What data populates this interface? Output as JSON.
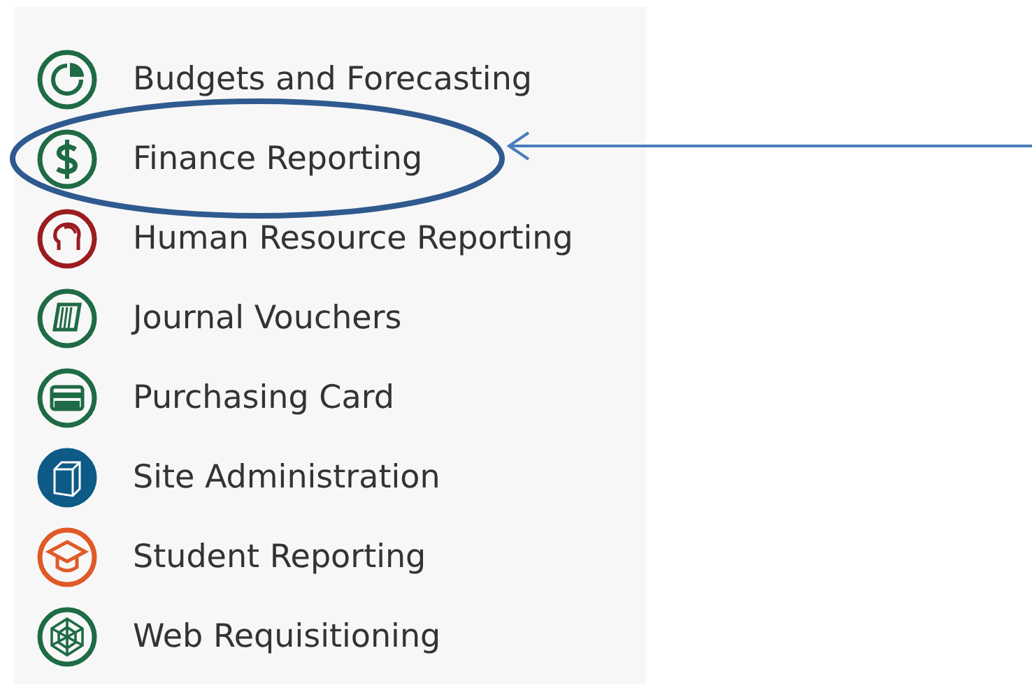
{
  "menu": {
    "items": [
      {
        "label": "Budgets and Forecasting",
        "kind": "pie",
        "color": "#1e6b45",
        "highlighted": false
      },
      {
        "label": "Finance Reporting",
        "kind": "dollar",
        "color": "#1e6b45",
        "highlighted": true
      },
      {
        "label": "Human Resource Reporting",
        "kind": "people",
        "color": "#9b1c1f",
        "highlighted": false
      },
      {
        "label": "Journal Vouchers",
        "kind": "book",
        "color": "#1e6b45",
        "highlighted": false
      },
      {
        "label": "Purchasing Card",
        "kind": "card",
        "color": "#1e6b45",
        "highlighted": false
      },
      {
        "label": "Site Administration",
        "kind": "box",
        "color": "#0d5a86",
        "highlighted": false
      },
      {
        "label": "Student Reporting",
        "kind": "cap",
        "color": "#e05a28",
        "highlighted": false
      },
      {
        "label": "Web Requisitioning",
        "kind": "web",
        "color": "#1e6b45",
        "highlighted": false
      }
    ]
  }
}
